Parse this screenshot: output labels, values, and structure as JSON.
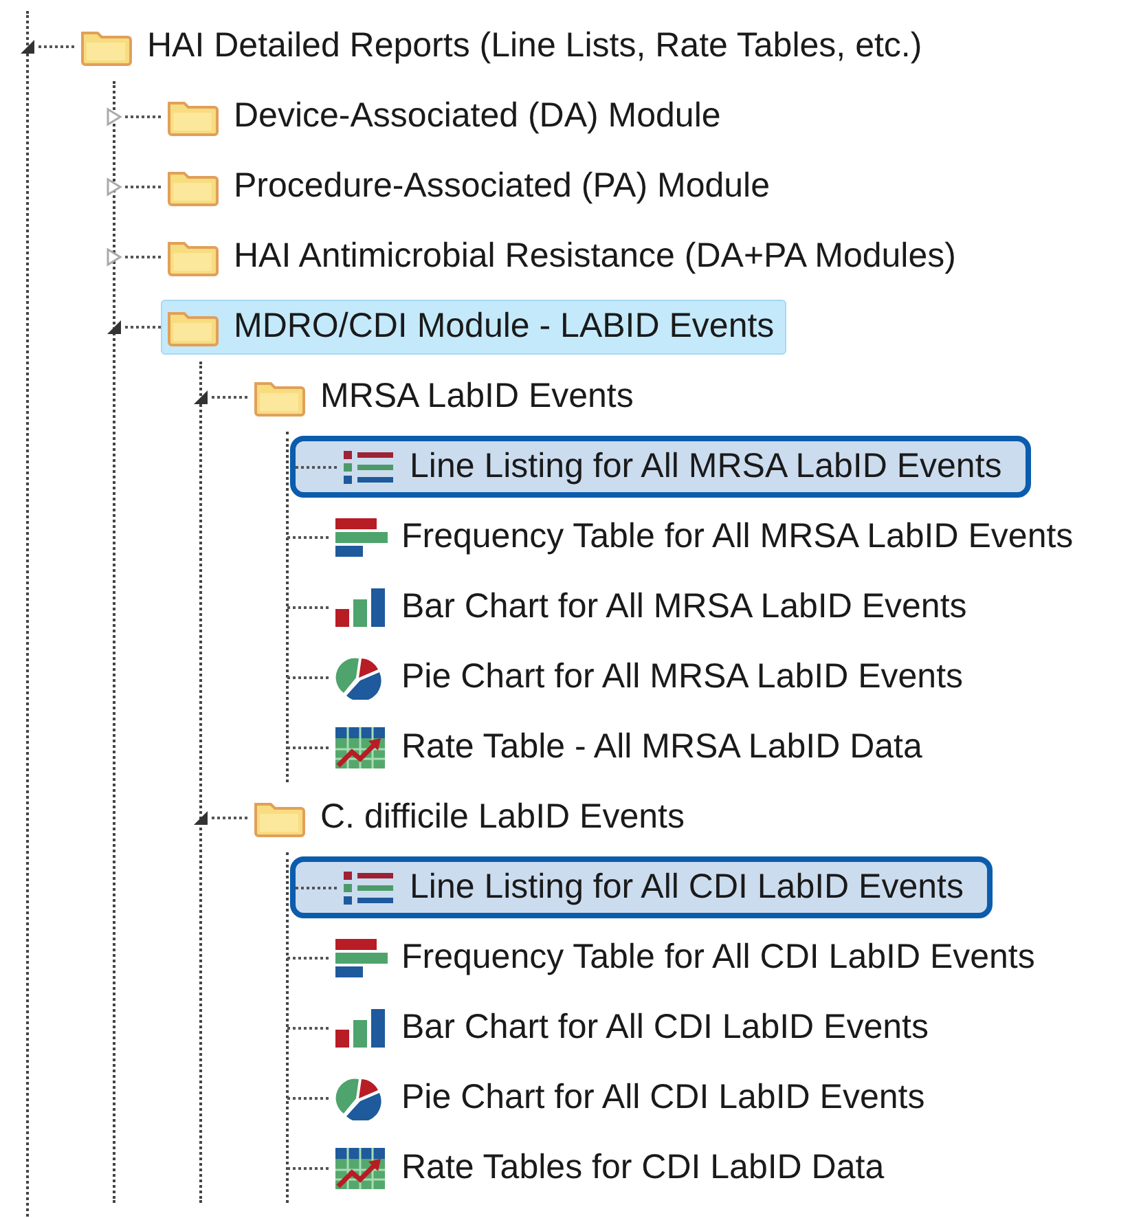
{
  "tree": [
    {
      "label": "HAI Detailed Reports (Line Lists, Rate Tables, etc.)",
      "kind": "folder",
      "expanded": true,
      "selected": false,
      "outlined": false,
      "children": [
        {
          "label": "Device-Associated (DA) Module",
          "kind": "folder",
          "expanded": false,
          "selected": false,
          "outlined": false
        },
        {
          "label": "Procedure-Associated (PA) Module",
          "kind": "folder",
          "expanded": false,
          "selected": false,
          "outlined": false
        },
        {
          "label": "HAI Antimicrobial Resistance (DA+PA Modules)",
          "kind": "folder",
          "expanded": false,
          "selected": false,
          "outlined": false
        },
        {
          "label": "MDRO/CDI Module - LABID Events",
          "kind": "folder",
          "expanded": true,
          "selected": true,
          "outlined": false,
          "children": [
            {
              "label": "MRSA LabID Events",
              "kind": "folder",
              "expanded": true,
              "selected": false,
              "outlined": false,
              "children": [
                {
                  "label": "Line Listing for All MRSA LabID Events",
                  "kind": "line-listing",
                  "selected": false,
                  "outlined": true
                },
                {
                  "label": "Frequency Table for All MRSA LabID Events",
                  "kind": "frequency-table",
                  "selected": false,
                  "outlined": false
                },
                {
                  "label": "Bar Chart for All MRSA LabID Events",
                  "kind": "bar-chart",
                  "selected": false,
                  "outlined": false
                },
                {
                  "label": "Pie Chart for All MRSA LabID Events",
                  "kind": "pie-chart",
                  "selected": false,
                  "outlined": false
                },
                {
                  "label": "Rate Table - All MRSA LabID Data",
                  "kind": "rate-table",
                  "selected": false,
                  "outlined": false
                }
              ]
            },
            {
              "label": "C. difficile LabID Events",
              "kind": "folder",
              "expanded": true,
              "selected": false,
              "outlined": false,
              "children": [
                {
                  "label": "Line Listing for All CDI LabID Events",
                  "kind": "line-listing",
                  "selected": false,
                  "outlined": true
                },
                {
                  "label": "Frequency Table for All CDI LabID Events",
                  "kind": "frequency-table",
                  "selected": false,
                  "outlined": false
                },
                {
                  "label": "Bar Chart for All CDI LabID Events",
                  "kind": "bar-chart",
                  "selected": false,
                  "outlined": false
                },
                {
                  "label": "Pie Chart for All CDI LabID Events",
                  "kind": "pie-chart",
                  "selected": false,
                  "outlined": false
                },
                {
                  "label": "Rate Tables for CDI LabID Data",
                  "kind": "rate-table",
                  "selected": false,
                  "outlined": false
                }
              ]
            }
          ]
        }
      ]
    }
  ]
}
